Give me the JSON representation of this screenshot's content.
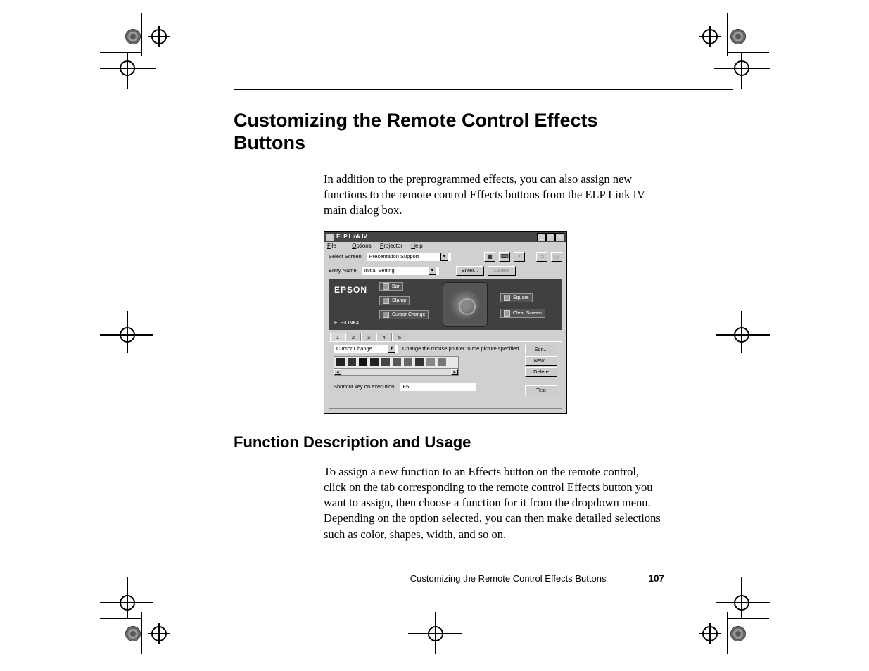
{
  "heading": "Customizing the Remote Control Effects Buttons",
  "intro": "In addition to the preprogrammed effects, you can also assign new functions to the remote control Effects buttons from the ELP Link IV main dialog box.",
  "subheading": "Function Description and Usage",
  "body2": "To assign a new function to an Effects button on the remote control, click on the tab corresponding to the remote control Effects button you want to assign, then choose a function for it from the dropdown menu. Depending on the option selected, you can then make detailed selections such as color, shapes, width, and so on.",
  "footer_title": "Customizing the Remote Control Effects Buttons",
  "page_number": "107",
  "win": {
    "title": "ELP Link IV",
    "menu": {
      "file": "File",
      "options": "Options",
      "projector": "Projector",
      "help": "Help"
    },
    "select_screen_label": "Select Screen:",
    "select_screen_value": "Presentation Support",
    "entry_name_label": "Entry Name:",
    "entry_name_value": "Initial Setting",
    "enter_btn": "Enter...",
    "delete_entry_btn": "Delete",
    "brand": "EPSON",
    "brand2": "ELP-LINK4",
    "effects": {
      "bar": "Bar",
      "stamp": "Stamp",
      "cursor": "Cursor Change",
      "square": "Square",
      "clear": "Clear Screen"
    },
    "tabs": [
      "1",
      "2",
      "3",
      "4",
      "5"
    ],
    "function_value": "Cursor Change",
    "function_hint": "Change the mouse pointer to the picture specified.",
    "side": {
      "edit": "Edit...",
      "new": "New...",
      "delete": "Delete",
      "test": "Test"
    },
    "shortcut_label": "Shortcut key on execution:",
    "shortcut_value": "F5"
  }
}
